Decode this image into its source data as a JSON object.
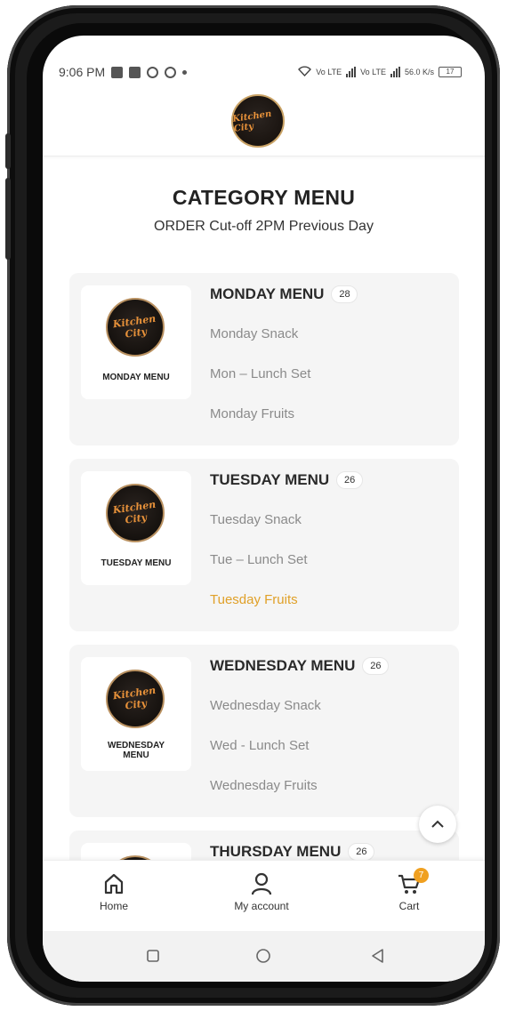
{
  "status_bar": {
    "time": "9:06 PM",
    "right_indicators": [
      "Vo LTE",
      "4G",
      "Vo LTE",
      "4G",
      "56.0 K/s"
    ],
    "battery": "17"
  },
  "header": {
    "logo_text": "Kitchen City"
  },
  "page": {
    "title": "CATEGORY MENU",
    "subtitle": "ORDER Cut-off 2PM Previous Day"
  },
  "categories": [
    {
      "title": "MONDAY MENU",
      "count": "28",
      "thumb_label": "MONDAY MENU",
      "items": [
        "Monday Snack",
        "Mon – Lunch Set",
        "Monday Fruits"
      ],
      "active_item": -1
    },
    {
      "title": "TUESDAY MENU",
      "count": "26",
      "thumb_label": "TUESDAY MENU",
      "items": [
        "Tuesday Snack",
        "Tue – Lunch Set",
        "Tuesday Fruits"
      ],
      "active_item": 2
    },
    {
      "title": "WEDNESDAY MENU",
      "count": "26",
      "thumb_label": "WEDNESDAY MENU",
      "items": [
        "Wednesday Snack",
        "Wed - Lunch Set",
        "Wednesday Fruits"
      ],
      "active_item": -1
    },
    {
      "title": "THURSDAY MENU",
      "count": "26",
      "thumb_label": "",
      "items": [],
      "active_item": -1
    }
  ],
  "bottom_nav": {
    "home": "Home",
    "account": "My account",
    "cart": "Cart",
    "cart_count": "7"
  },
  "colors": {
    "accent": "#e0a028",
    "badge": "#f0a020"
  },
  "icons": [
    "home-icon",
    "user-icon",
    "cart-icon",
    "chevron-up-icon",
    "square-icon",
    "circle-icon",
    "back-triangle-icon"
  ]
}
